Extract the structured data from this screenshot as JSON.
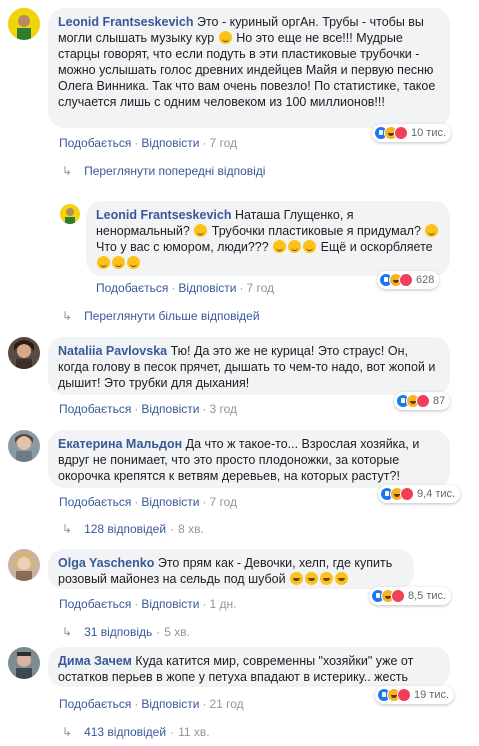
{
  "comments": [
    {
      "author": "Leonid Frantseskevich",
      "text": "Это - куриный оргАн. Трубы - чтобы вы могли слышать музыку кур",
      "text2": " Но это еще не все!!! Мудрые старцы говорят, что если подуть в эти пластиковые трубочки - можно услышать голос древних индейцев Майя и первую песню Олега Винника. Так что вам очень повезло! По статистике, такое случается лишь с одним человеком из 100 миллионов!!!",
      "reactions": "10 тис.",
      "like": "Подобається",
      "reply": "Відповісти",
      "time": "7 год",
      "more": "Переглянути попередні відповіді"
    },
    {
      "author": "Leonid Frantseskevich",
      "text": "Наташа Глущенко, я ненормальный?",
      "text2": " Трубочки пластиковые я придумал?",
      "text3": " Что у вас с юмором, люди???",
      "text4": " Ещё и оскорбляете",
      "reactions": "628",
      "like": "Подобається",
      "reply": "Відповісти",
      "time": "7 год",
      "more": "Переглянути більше відповідей"
    },
    {
      "author": "Nataliia Pavlovska",
      "text": "Тю! Да это же не курица! Это страус! Он, когда голову в песок прячет, дышать то чем-то надо, вот жопой и дышит! Это трубки для дыхания!",
      "reactions": "87",
      "like": "Подобається",
      "reply": "Відповісти",
      "time": "3 год"
    },
    {
      "author": "Екатерина Мальдон",
      "text": "Да что ж такое-то... Взрослая хозяйка, и вдруг не понимает, что это просто плодоножки, за которые окорочка крепятся к ветвям деревьев, на которых растут?!",
      "reactions": "9,4 тис.",
      "like": "Подобається",
      "reply": "Відповісти",
      "time": "7 год",
      "replies": "128 відповідей",
      "replies_time": "8 хв."
    },
    {
      "author": "Olga Yaschenko",
      "text": "Это прям как - Девочки, хелп, где купить розовый майонез на сельдь под шубой",
      "reactions": "8,5 тис.",
      "like": "Подобається",
      "reply": "Відповісти",
      "time": "1 дн.",
      "replies": "31 відповідь",
      "replies_time": "5 хв."
    },
    {
      "author": "Дима Зачем",
      "text": "Куда катится мир, современны \"хозяйки\" уже от остатков перьев в жопе у петуха впадают в истерику.. жесть",
      "reactions": "19 тис.",
      "like": "Подобається",
      "reply": "Відповісти",
      "time": "21 год",
      "replies": "413 відповідей",
      "replies_time": "11 хв."
    }
  ],
  "separator": "·",
  "colors": {
    "link": "#385898",
    "bubble": "#f2f3f5",
    "meta": "#90949c"
  }
}
